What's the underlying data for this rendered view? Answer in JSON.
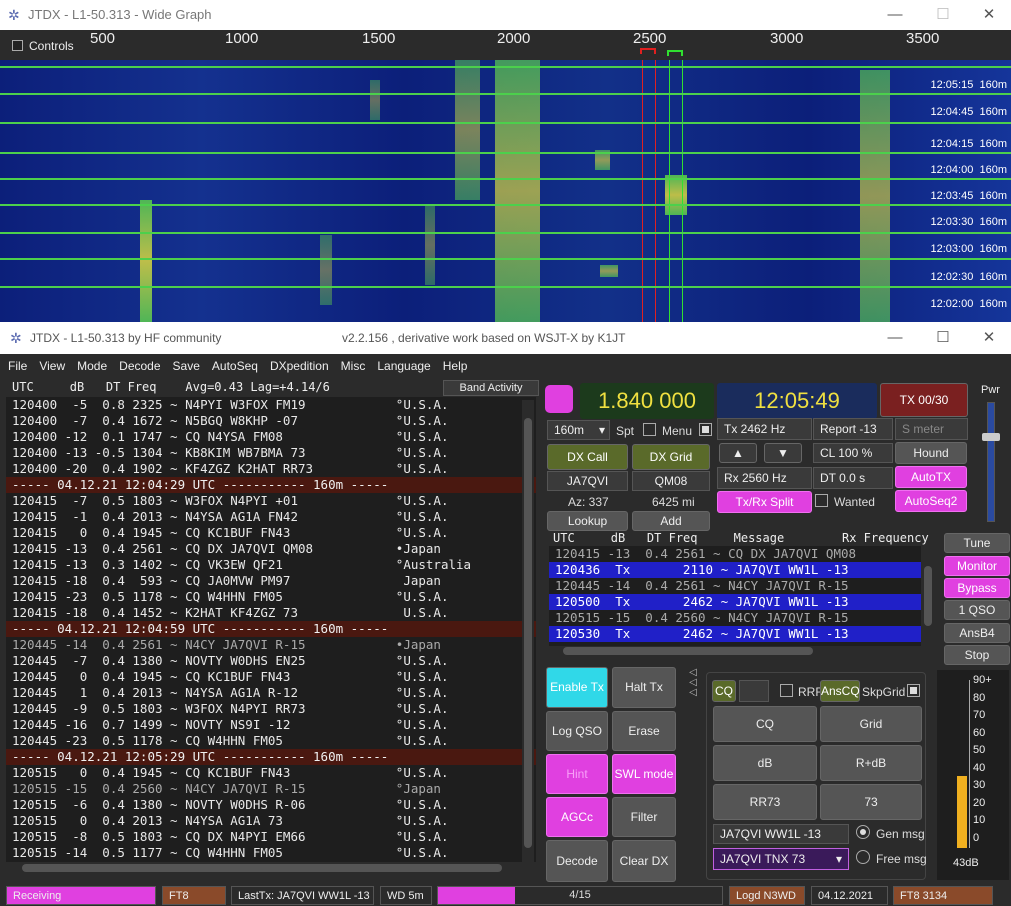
{
  "wide_graph": {
    "title": "JTDX - L1-50.313 - Wide Graph",
    "controls_label": "Controls",
    "ticks": [
      "500",
      "1000",
      "1500",
      "2000",
      "2500",
      "3000",
      "3500"
    ],
    "rows": [
      {
        "time": "12:05:15",
        "band": "160m"
      },
      {
        "time": "12:04:45",
        "band": "160m"
      },
      {
        "time": "12:04:15",
        "band": "160m"
      },
      {
        "time": "12:04:00",
        "band": "160m"
      },
      {
        "time": "12:03:45",
        "band": "160m"
      },
      {
        "time": "12:03:30",
        "band": "160m"
      },
      {
        "time": "12:03:00",
        "band": "160m"
      },
      {
        "time": "12:02:30",
        "band": "160m"
      },
      {
        "time": "12:02:00",
        "band": "160m"
      }
    ]
  },
  "main": {
    "title": "JTDX - L1-50.313  by HF community",
    "version": "v2.2.156 , derivative work based on WSJT-X by K1JT",
    "menu": [
      "File",
      "View",
      "Mode",
      "Decode",
      "Save",
      "AutoSeq",
      "DXpedition",
      "Misc",
      "Language",
      "Help"
    ]
  },
  "band_activity": {
    "header": "UTC     dB   DT Freq    Avg=0.43 Lag=+4.14/6",
    "button": "Band Activity",
    "rows": [
      {
        "t": "120400  -5  0.8 2325 ~ N4PYI W3FOX FM19            °U.S.A.",
        "c": ""
      },
      {
        "t": "120400  -7  0.4 1672 ~ N5BGQ W8KHP -07             °U.S.A.",
        "c": ""
      },
      {
        "t": "120400 -12  0.1 1747 ~ CQ N4YSA FM08               °U.S.A.",
        "c": ""
      },
      {
        "t": "120400 -13 -0.5 1304 ~ KB8KIM WB7BMA 73            °U.S.A.",
        "c": ""
      },
      {
        "t": "120400 -20  0.4 1902 ~ KF4ZGZ K2HAT RR73           °U.S.A.",
        "c": ""
      },
      {
        "t": "----- 04.12.21 12:04:29 UTC ----------- 160m -----",
        "c": "sep"
      },
      {
        "t": "120415  -7  0.5 1803 ~ W3FOX N4PYI +01             °U.S.A.",
        "c": ""
      },
      {
        "t": "120415  -1  0.4 2013 ~ N4YSA AG1A FN42             °U.S.A.",
        "c": ""
      },
      {
        "t": "120415   0  0.4 1945 ~ CQ KC1BUF FN43              °U.S.A.",
        "c": ""
      },
      {
        "t": "120415 -13  0.4 2561 ~ CQ DX JA7QVI QM08           •Japan",
        "c": ""
      },
      {
        "t": "120415 -13  0.3 1402 ~ CQ VK3EW QF21               °Australia",
        "c": ""
      },
      {
        "t": "120415 -18  0.4  593 ~ CQ JA0MVW PM97               Japan",
        "c": ""
      },
      {
        "t": "120415 -23  0.5 1178 ~ CQ W4HHN FM05               °U.S.A.",
        "c": ""
      },
      {
        "t": "120415 -18  0.4 1452 ~ K2HAT KF4ZGZ 73              U.S.A.",
        "c": ""
      },
      {
        "t": "----- 04.12.21 12:04:59 UTC ----------- 160m -----",
        "c": "sep"
      },
      {
        "t": "120445 -14  0.4 2561 ~ N4CY JA7QVI R-15            •Japan",
        "c": "dim"
      },
      {
        "t": "120445  -7  0.4 1380 ~ NOVTY W0DHS EN25            °U.S.A.",
        "c": ""
      },
      {
        "t": "120445   0  0.4 1945 ~ CQ KC1BUF FN43              °U.S.A.",
        "c": ""
      },
      {
        "t": "120445   1  0.4 2013 ~ N4YSA AG1A R-12             °U.S.A.",
        "c": ""
      },
      {
        "t": "120445  -9  0.5 1803 ~ W3FOX N4PYI RR73            °U.S.A.",
        "c": ""
      },
      {
        "t": "120445 -16  0.7 1499 ~ NOVTY NS9I -12              °U.S.A.",
        "c": ""
      },
      {
        "t": "120445 -23  0.5 1178 ~ CQ W4HHN FM05               °U.S.A.",
        "c": ""
      },
      {
        "t": "----- 04.12.21 12:05:29 UTC ----------- 160m -----",
        "c": "sep"
      },
      {
        "t": "120515   0  0.4 1945 ~ CQ KC1BUF FN43              °U.S.A.",
        "c": ""
      },
      {
        "t": "120515 -15  0.4 2560 ~ N4CY JA7QVI R-15            °Japan",
        "c": "dim"
      },
      {
        "t": "120515  -6  0.4 1380 ~ NOVTY W0DHS R-06            °U.S.A.",
        "c": ""
      },
      {
        "t": "120515   0  0.4 2013 ~ N4YSA AG1A 73               °U.S.A.",
        "c": ""
      },
      {
        "t": "120515  -8  0.5 1803 ~ CQ DX N4PYI EM66            °U.S.A.",
        "c": ""
      },
      {
        "t": "120515 -14  0.5 1177 ~ CQ W4HHN FM05               °U.S.A.",
        "c": ""
      }
    ]
  },
  "controls": {
    "dial_freq": "1.840 000",
    "clock": "12:05:49",
    "tx_counter": "TX 00/30",
    "pwr": "Pwr",
    "band": "160m",
    "spt": "Spt",
    "menu": "Menu",
    "tx_hz": "Tx  2462  Hz",
    "report": "Report -13",
    "smeter": "S meter",
    "dx_call_btn": "DX Call",
    "dx_grid_btn": "DX Grid",
    "dx_call": "JA7QVI",
    "dx_grid": "QM08",
    "az": "Az: 337",
    "dist": "6425 mi",
    "lookup": "Lookup",
    "add": "Add",
    "cl": "CL  100 %",
    "hound": "Hound",
    "rx_hz": "Rx  2560  Hz",
    "dt": "DT 0.0 s",
    "autotx": "AutoTX",
    "txrx_split": "Tx/Rx Split",
    "wanted": "Wanted",
    "autoseq2": "AutoSeq2"
  },
  "rx_list": {
    "header": "UTC     dB   DT Freq     Message        Rx Frequency",
    "rows": [
      {
        "t": "120415 -13  0.4 2561 ~ CQ DX JA7QVI QM08",
        "c": ""
      },
      {
        "t": "120436  Tx       2110 ~ JA7QVI WW1L -13",
        "c": "tx"
      },
      {
        "t": "120445 -14  0.4 2561 ~ N4CY JA7QVI R-15",
        "c": ""
      },
      {
        "t": "120500  Tx       2462 ~ JA7QVI WW1L -13",
        "c": "tx"
      },
      {
        "t": "120515 -15  0.4 2560 ~ N4CY JA7QVI R-15",
        "c": ""
      },
      {
        "t": "120530  Tx       2462 ~ JA7QVI WW1L -13",
        "c": "tx"
      }
    ]
  },
  "right_buttons": [
    "Tune",
    "Monitor",
    "Bypass",
    "1 QSO",
    "AnsB4",
    "Stop"
  ],
  "left_buttons": {
    "enable_tx": "Enable Tx",
    "halt_tx": "Halt Tx",
    "log_qso": "Log QSO",
    "erase": "Erase",
    "hint": "Hint",
    "swl": "SWL mode",
    "agcc": "AGCc",
    "filter": "Filter",
    "decode": "Decode",
    "clear_dx": "Clear DX"
  },
  "tx_panel": {
    "cq": "CQ",
    "rrr": "RRR",
    "anscq": "AnsCQ",
    "skpgrid": "SkpGrid",
    "grid_btns": [
      "CQ",
      "Grid",
      "dB",
      "R+dB",
      "RR73",
      "73"
    ],
    "gen_msg_text": "JA7QVI WW1L -13",
    "gen_msg": "Gen msg",
    "free_msg_text": "JA7QVI TNX 73",
    "free_msg": "Free msg"
  },
  "meter": {
    "labels": [
      "90+",
      "80",
      "70",
      "60",
      "50",
      "40",
      "30",
      "20",
      "10",
      "0"
    ],
    "level_db": "43dB",
    "level_fraction": 0.43
  },
  "status": {
    "receiving": "Receiving",
    "mode": "FT8",
    "lasttx": "LastTx: JA7QVI WW1L -13",
    "wd": "WD 5m",
    "progress": "4/15",
    "progress_fraction": 0.27,
    "logd": "Logd N3WD",
    "date": "04.12.2021",
    "ft8count": "FT8  3134"
  }
}
